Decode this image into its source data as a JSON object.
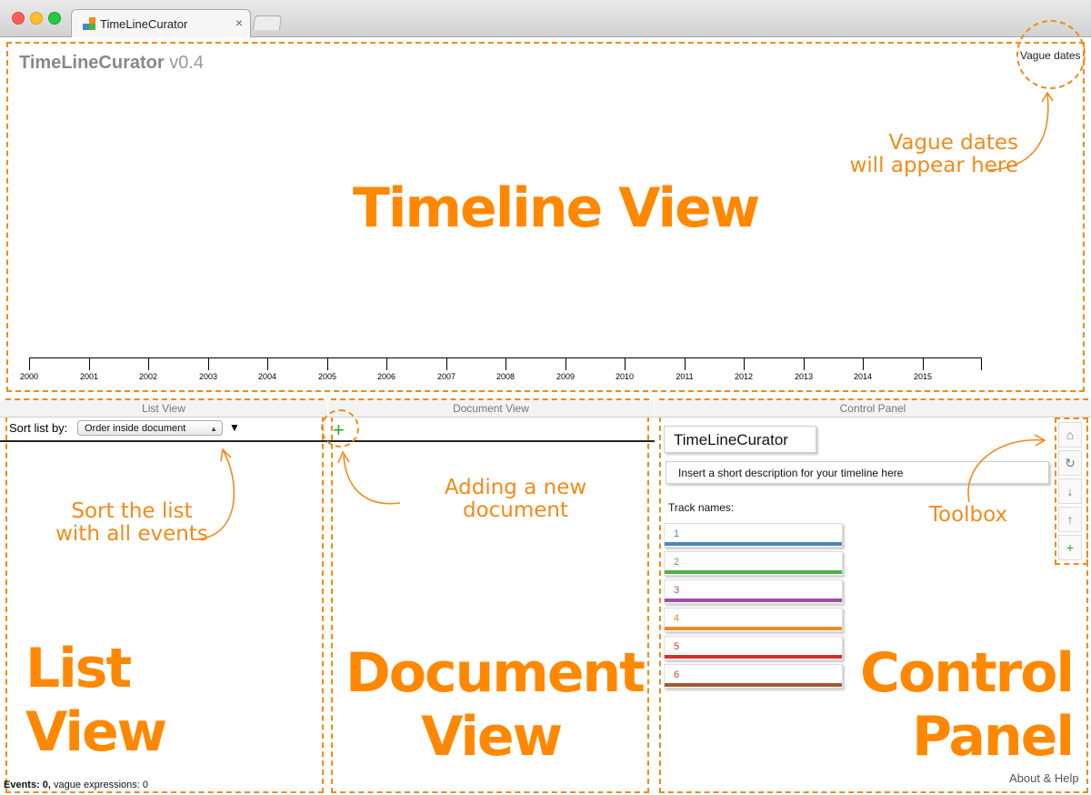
{
  "browser": {
    "tab_title": "TimeLineCurator",
    "tab_close": "×"
  },
  "app": {
    "name": "TimeLineCurator",
    "version": "v0.4"
  },
  "timeline": {
    "vague_button": "Vague dates",
    "years": [
      "2000",
      "2001",
      "2002",
      "2003",
      "2004",
      "2005",
      "2006",
      "2007",
      "2008",
      "2009",
      "2010",
      "2011",
      "2012",
      "2013",
      "2014",
      "2015"
    ]
  },
  "list_view": {
    "header": "List View",
    "sort_label": "Sort list by:",
    "sort_value": "Order inside document",
    "sort_direction": "▼",
    "status_prefix": "Events: 0,",
    "status_suffix": " vague expressions: 0"
  },
  "document_view": {
    "header": "Document View",
    "add_icon": "+"
  },
  "control_panel": {
    "header": "Control Panel",
    "title_value": "TimeLineCurator",
    "description_placeholder": "Insert a short description for your timeline here",
    "track_label": "Track names:",
    "tracks": [
      {
        "label": "1",
        "color": "#4a86c0"
      },
      {
        "label": "2",
        "color": "#4fb047"
      },
      {
        "label": "3",
        "color": "#9b4fa5"
      },
      {
        "label": "4",
        "color": "#f28a1b"
      },
      {
        "label": "5",
        "color": "#d62d2d"
      },
      {
        "label": "6",
        "color": "#a8572e"
      }
    ],
    "toolbox_icons": [
      "home-icon",
      "refresh-icon",
      "arrow-down-icon",
      "arrow-up-icon",
      "plus-icon"
    ],
    "about": "About & Help"
  },
  "annotations": {
    "timeline_view": "Timeline View",
    "vague_note_1": "Vague dates",
    "vague_note_2": "will appear here",
    "sort_note_1": "Sort the list",
    "sort_note_2": "with all events",
    "add_doc_note": "Adding a new document",
    "toolbox_note": "Toolbox",
    "list_view_1": "List",
    "list_view_2": "View",
    "doc_view_1": "Document",
    "doc_view_2": "View",
    "cp_1": "Control",
    "cp_2": "Panel"
  },
  "colors": {
    "accent": "#f28a1b"
  }
}
